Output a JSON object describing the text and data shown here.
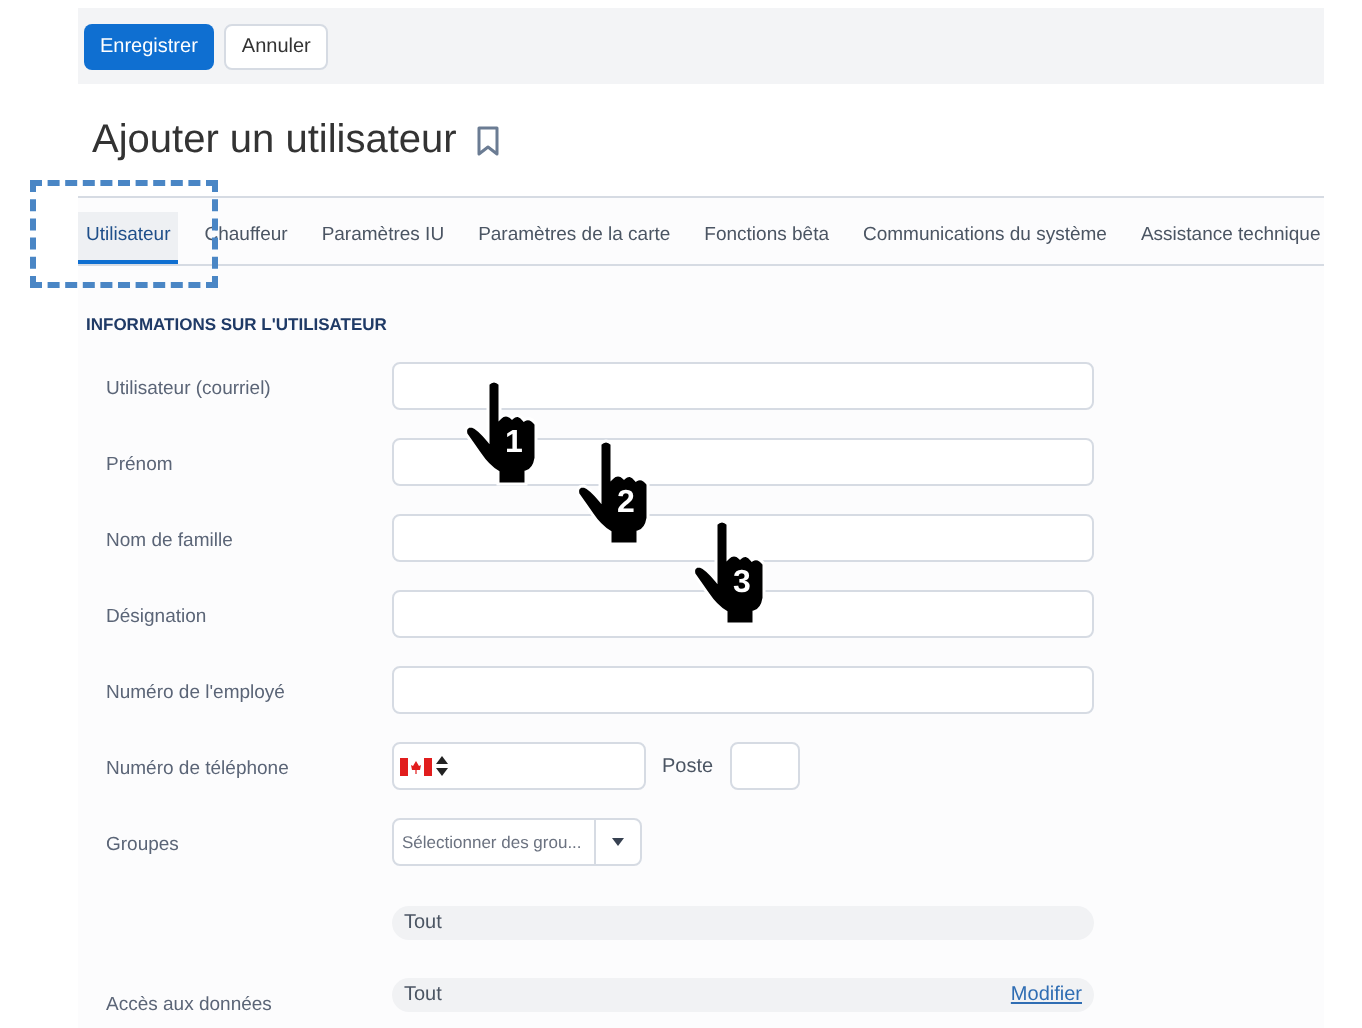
{
  "toolbar": {
    "buttons": [
      {
        "label": "Enregistrer",
        "kind": "primary"
      },
      {
        "label": "Annuler",
        "kind": "secondary"
      }
    ]
  },
  "title": "Ajouter un utilisateur",
  "tabs": [
    {
      "label": "Utilisateur",
      "selected": true
    },
    {
      "label": "Chauffeur",
      "selected": false
    },
    {
      "label": "Paramètres IU",
      "selected": false
    },
    {
      "label": "Paramètres de la carte",
      "selected": false
    },
    {
      "label": "Fonctions bêta",
      "selected": false
    },
    {
      "label": "Communications du système",
      "selected": false
    },
    {
      "label": "Assistance technique",
      "selected": false
    }
  ],
  "section_heading": "INFORMATIONS SUR L'UTILISATEUR",
  "fields": [
    {
      "kind": "text",
      "label": "Utilisateur (courriel)"
    },
    {
      "kind": "text",
      "label": "Prénom"
    },
    {
      "kind": "text",
      "label": "Nom de famille"
    },
    {
      "kind": "text",
      "label": "Désignation"
    },
    {
      "kind": "text",
      "label": "Numéro de l'employé"
    },
    {
      "kind": "phone",
      "label": "Numéro de téléphone",
      "extension_label": "Poste"
    },
    {
      "kind": "select",
      "label": "Groupes",
      "placeholder": "Sélectionner des grou..."
    },
    {
      "kind": "pill",
      "value": "Tout"
    },
    {
      "kind": "pill",
      "label": "Accès aux données",
      "value": "Tout",
      "link": "Modifier"
    }
  ],
  "annotations": [
    {
      "number": "1"
    },
    {
      "number": "2"
    },
    {
      "number": "3"
    }
  ]
}
